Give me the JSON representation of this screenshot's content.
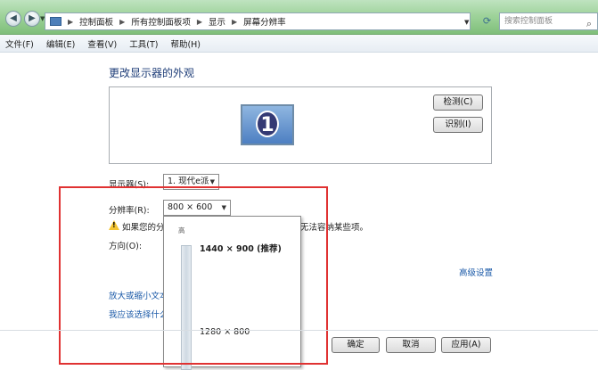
{
  "address_bar": {
    "segments": [
      "控制面板",
      "所有控制面板项",
      "显示",
      "屏幕分辨率"
    ],
    "search_placeholder": "搜索控制面板"
  },
  "menu": {
    "items": [
      "文件(F)",
      "编辑(E)",
      "查看(V)",
      "工具(T)",
      "帮助(H)"
    ]
  },
  "main": {
    "title": "更改显示器的外观",
    "monitor_number": "1",
    "detect_label": "检测(C)",
    "identify_label": "识别(I)",
    "display_label": "显示器(S):",
    "display_value": "1. 现代e派",
    "resolution_label": "分辨率(R):",
    "resolution_value": "800 × 600",
    "warning_left": "如果您的分",
    "warning_right": "无法容纳某些项。",
    "orientation_label": "方向(O):",
    "advanced_link": "高级设置",
    "textsize_link": "放大或缩小文本",
    "help_link": "我应该选择什么"
  },
  "dropdown": {
    "high_label": "高",
    "option_top": "1440 × 900 (推荐)",
    "option_mid": "1280 × 800"
  },
  "footer": {
    "ok_label": "确定",
    "cancel_label": "取消",
    "apply_label": "应用(A)"
  },
  "colors": {
    "link": "#1b5aa8",
    "highlight_box": "#e03232",
    "title": "#1e3d78"
  }
}
